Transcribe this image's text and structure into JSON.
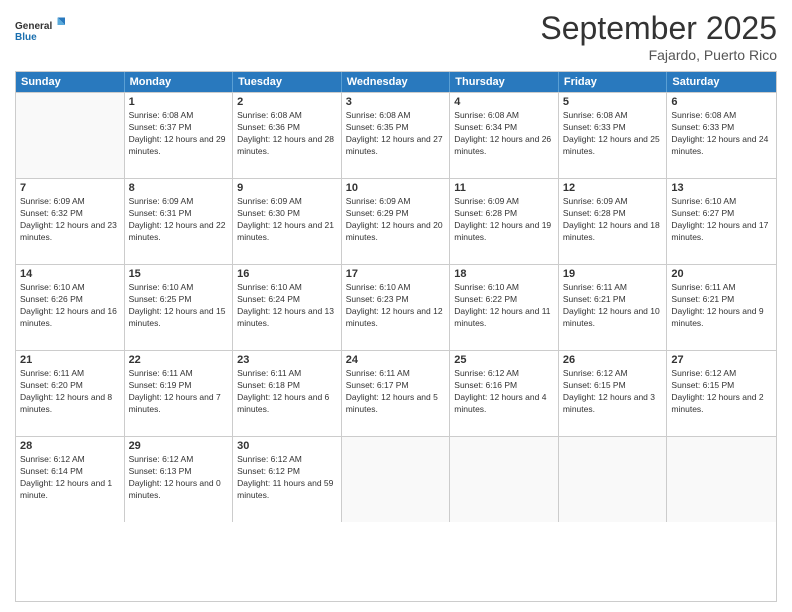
{
  "logo": {
    "line1": "General",
    "line2": "Blue"
  },
  "title": "September 2025",
  "location": "Fajardo, Puerto Rico",
  "days_of_week": [
    "Sunday",
    "Monday",
    "Tuesday",
    "Wednesday",
    "Thursday",
    "Friday",
    "Saturday"
  ],
  "weeks": [
    [
      {
        "day": "",
        "empty": true
      },
      {
        "day": "1",
        "sunrise": "6:08 AM",
        "sunset": "6:37 PM",
        "daylight": "12 hours and 29 minutes."
      },
      {
        "day": "2",
        "sunrise": "6:08 AM",
        "sunset": "6:36 PM",
        "daylight": "12 hours and 28 minutes."
      },
      {
        "day": "3",
        "sunrise": "6:08 AM",
        "sunset": "6:35 PM",
        "daylight": "12 hours and 27 minutes."
      },
      {
        "day": "4",
        "sunrise": "6:08 AM",
        "sunset": "6:34 PM",
        "daylight": "12 hours and 26 minutes."
      },
      {
        "day": "5",
        "sunrise": "6:08 AM",
        "sunset": "6:33 PM",
        "daylight": "12 hours and 25 minutes."
      },
      {
        "day": "6",
        "sunrise": "6:08 AM",
        "sunset": "6:33 PM",
        "daylight": "12 hours and 24 minutes."
      }
    ],
    [
      {
        "day": "7",
        "sunrise": "6:09 AM",
        "sunset": "6:32 PM",
        "daylight": "12 hours and 23 minutes."
      },
      {
        "day": "8",
        "sunrise": "6:09 AM",
        "sunset": "6:31 PM",
        "daylight": "12 hours and 22 minutes."
      },
      {
        "day": "9",
        "sunrise": "6:09 AM",
        "sunset": "6:30 PM",
        "daylight": "12 hours and 21 minutes."
      },
      {
        "day": "10",
        "sunrise": "6:09 AM",
        "sunset": "6:29 PM",
        "daylight": "12 hours and 20 minutes."
      },
      {
        "day": "11",
        "sunrise": "6:09 AM",
        "sunset": "6:28 PM",
        "daylight": "12 hours and 19 minutes."
      },
      {
        "day": "12",
        "sunrise": "6:09 AM",
        "sunset": "6:28 PM",
        "daylight": "12 hours and 18 minutes."
      },
      {
        "day": "13",
        "sunrise": "6:10 AM",
        "sunset": "6:27 PM",
        "daylight": "12 hours and 17 minutes."
      }
    ],
    [
      {
        "day": "14",
        "sunrise": "6:10 AM",
        "sunset": "6:26 PM",
        "daylight": "12 hours and 16 minutes."
      },
      {
        "day": "15",
        "sunrise": "6:10 AM",
        "sunset": "6:25 PM",
        "daylight": "12 hours and 15 minutes."
      },
      {
        "day": "16",
        "sunrise": "6:10 AM",
        "sunset": "6:24 PM",
        "daylight": "12 hours and 13 minutes."
      },
      {
        "day": "17",
        "sunrise": "6:10 AM",
        "sunset": "6:23 PM",
        "daylight": "12 hours and 12 minutes."
      },
      {
        "day": "18",
        "sunrise": "6:10 AM",
        "sunset": "6:22 PM",
        "daylight": "12 hours and 11 minutes."
      },
      {
        "day": "19",
        "sunrise": "6:11 AM",
        "sunset": "6:21 PM",
        "daylight": "12 hours and 10 minutes."
      },
      {
        "day": "20",
        "sunrise": "6:11 AM",
        "sunset": "6:21 PM",
        "daylight": "12 hours and 9 minutes."
      }
    ],
    [
      {
        "day": "21",
        "sunrise": "6:11 AM",
        "sunset": "6:20 PM",
        "daylight": "12 hours and 8 minutes."
      },
      {
        "day": "22",
        "sunrise": "6:11 AM",
        "sunset": "6:19 PM",
        "daylight": "12 hours and 7 minutes."
      },
      {
        "day": "23",
        "sunrise": "6:11 AM",
        "sunset": "6:18 PM",
        "daylight": "12 hours and 6 minutes."
      },
      {
        "day": "24",
        "sunrise": "6:11 AM",
        "sunset": "6:17 PM",
        "daylight": "12 hours and 5 minutes."
      },
      {
        "day": "25",
        "sunrise": "6:12 AM",
        "sunset": "6:16 PM",
        "daylight": "12 hours and 4 minutes."
      },
      {
        "day": "26",
        "sunrise": "6:12 AM",
        "sunset": "6:15 PM",
        "daylight": "12 hours and 3 minutes."
      },
      {
        "day": "27",
        "sunrise": "6:12 AM",
        "sunset": "6:15 PM",
        "daylight": "12 hours and 2 minutes."
      }
    ],
    [
      {
        "day": "28",
        "sunrise": "6:12 AM",
        "sunset": "6:14 PM",
        "daylight": "12 hours and 1 minute."
      },
      {
        "day": "29",
        "sunrise": "6:12 AM",
        "sunset": "6:13 PM",
        "daylight": "12 hours and 0 minutes."
      },
      {
        "day": "30",
        "sunrise": "6:12 AM",
        "sunset": "6:12 PM",
        "daylight": "11 hours and 59 minutes."
      },
      {
        "day": "",
        "empty": true
      },
      {
        "day": "",
        "empty": true
      },
      {
        "day": "",
        "empty": true
      },
      {
        "day": "",
        "empty": true
      }
    ]
  ]
}
